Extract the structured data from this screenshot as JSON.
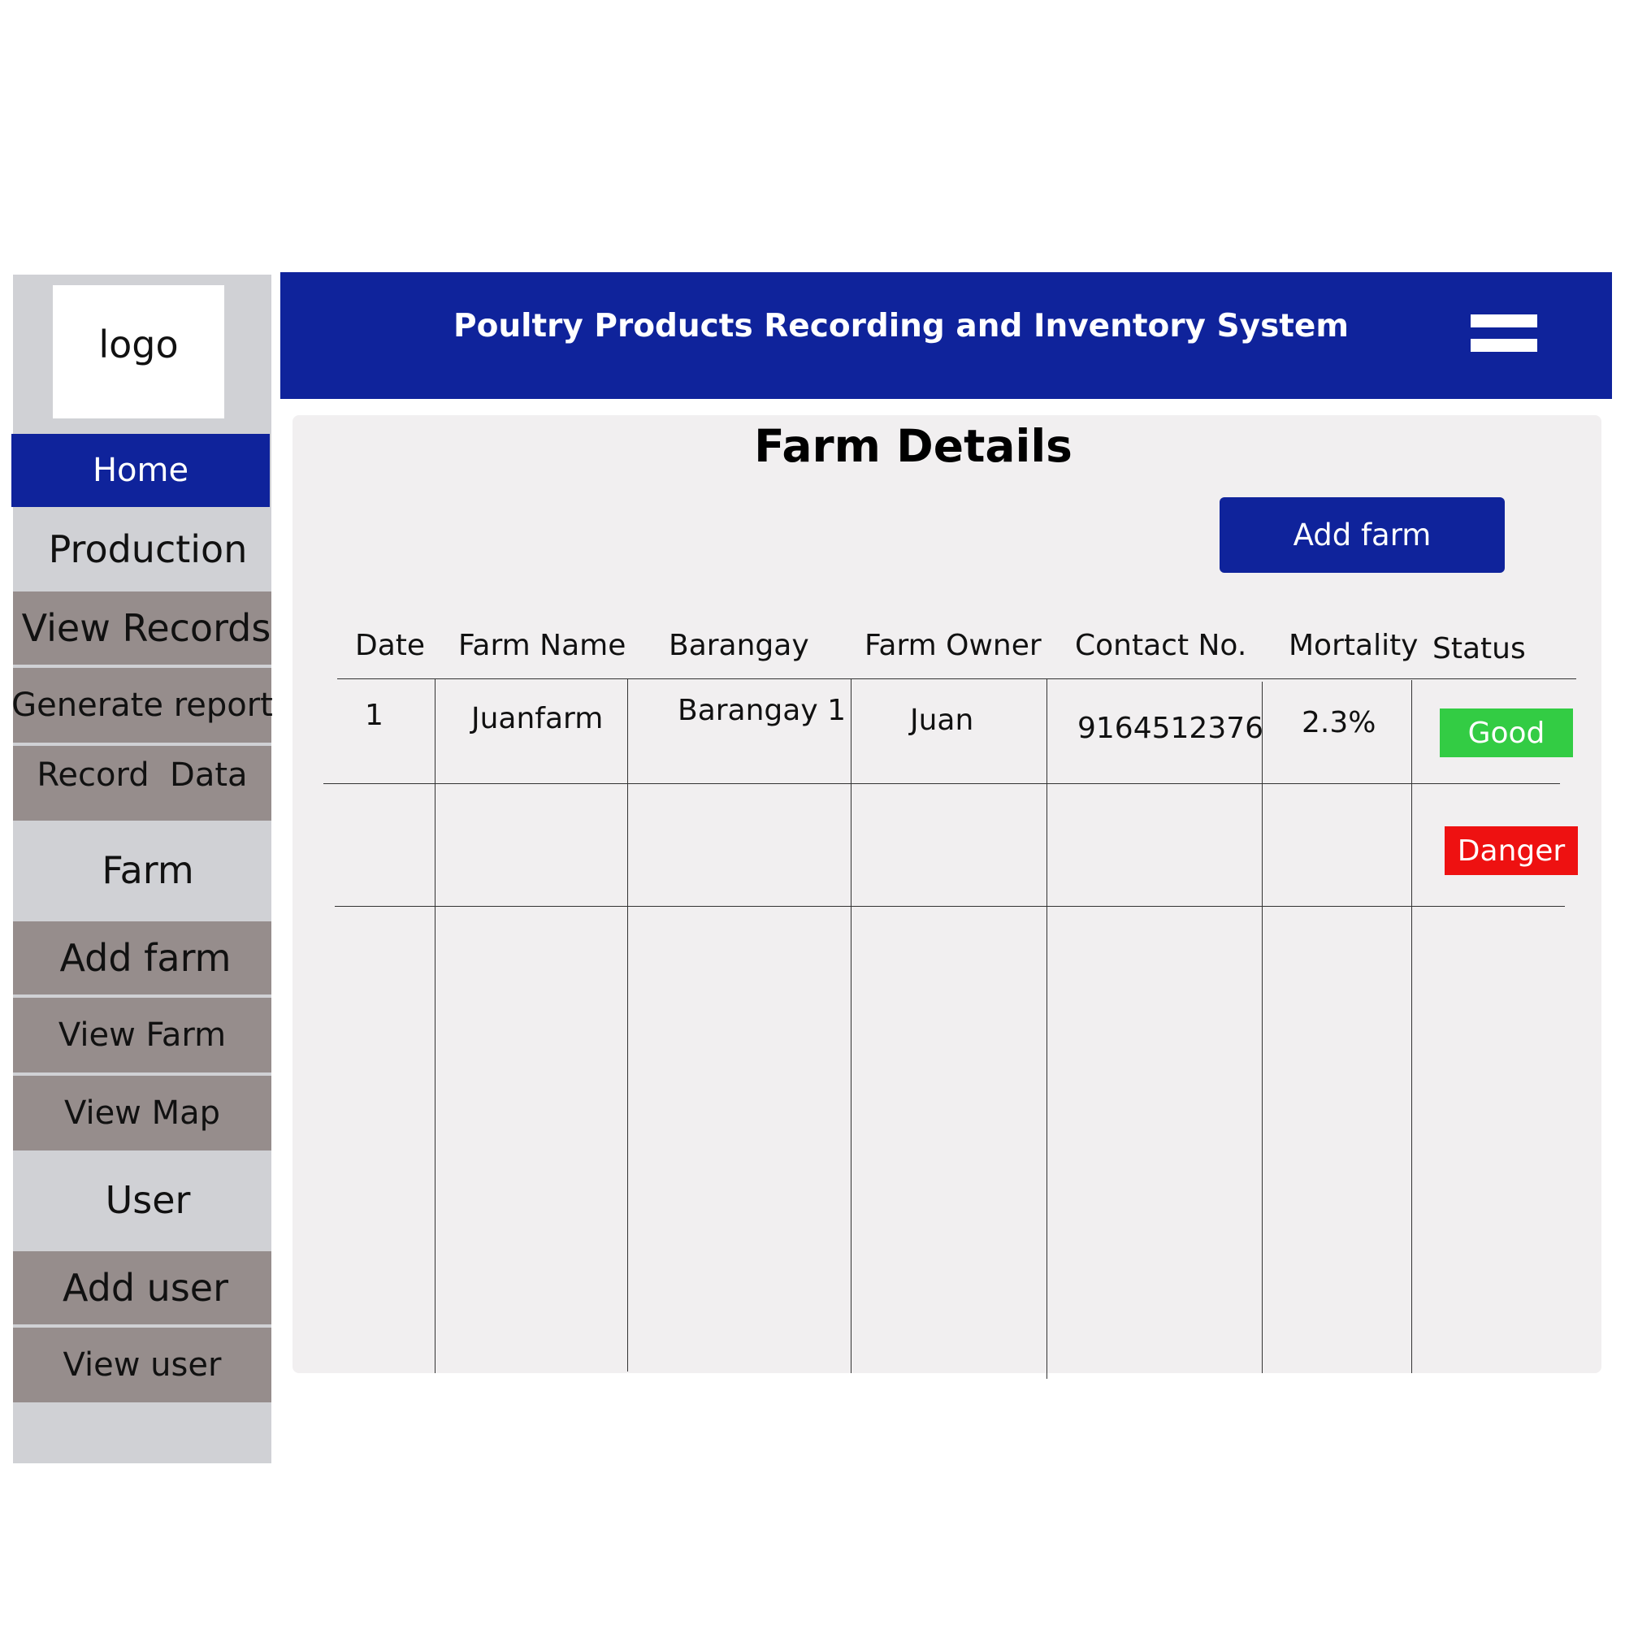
{
  "logo": "logo",
  "header": {
    "title": "Poultry Products Recording and Inventory System",
    "menu_icon": "hamburger-menu-icon"
  },
  "sidebar": {
    "home": "Home",
    "production": {
      "label": "Production",
      "items": [
        "View Records",
        "Generate report",
        "Record  Data"
      ]
    },
    "farm": {
      "label": "Farm",
      "items": [
        "Add farm",
        "View Farm",
        "View Map"
      ]
    },
    "user": {
      "label": "User",
      "items": [
        "Add user",
        "View user"
      ]
    }
  },
  "main": {
    "title": "Farm Details",
    "add_button": "Add farm",
    "columns": [
      "Date",
      "Farm Name",
      "Barangay",
      "Farm Owner",
      "Contact No.",
      "Mortality",
      "Status"
    ],
    "rows": [
      {
        "date": "1",
        "farm_name": "Juanfarm",
        "barangay": "Barangay 1",
        "owner": "Juan",
        "contact": "9164512376",
        "mortality": "2.3%",
        "status": "Good"
      },
      {
        "status": "Danger"
      }
    ]
  },
  "colors": {
    "primary": "#0f239b",
    "sidebar_bg": "#d0d1d5",
    "sidebar_sub": "#968d8c",
    "panel_bg": "#f1eff0",
    "good": "#33cc44",
    "danger": "#ee1111"
  }
}
